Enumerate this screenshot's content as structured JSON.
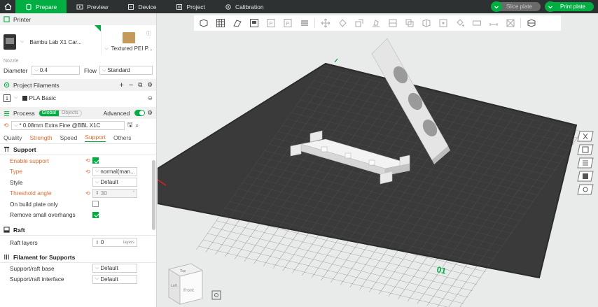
{
  "tabs": [
    {
      "label": "Prepare",
      "icon": "prepare-icon",
      "active": true
    },
    {
      "label": "Preview",
      "icon": "preview-icon",
      "active": false
    },
    {
      "label": "Device",
      "icon": "device-icon",
      "active": false
    },
    {
      "label": "Project",
      "icon": "project-icon",
      "active": false
    },
    {
      "label": "Calibration",
      "icon": "calibration-icon",
      "active": false
    }
  ],
  "actions": {
    "slice": "Slice plate",
    "print": "Print plate"
  },
  "printer": {
    "heading": "Printer",
    "name": "Bambu Lab X1 Car...",
    "plate": "Textured PEI P...",
    "nozzle_label": "Nozzle",
    "diameter_label": "Diameter",
    "diameter_value": "0.4",
    "flow_label": "Flow",
    "flow_value": "Standard"
  },
  "filaments": {
    "heading": "Project Filaments",
    "items": [
      {
        "index": "1",
        "name": "PLA Basic"
      }
    ]
  },
  "process": {
    "heading": "Process",
    "global": "Global",
    "objects": "Objects",
    "advanced": "Advanced",
    "profile": "* 0.08mm Extra Fine @BBL X1C",
    "subtabs": [
      "Quality",
      "Strength",
      "Speed",
      "Support",
      "Others"
    ]
  },
  "support": {
    "title": "Support",
    "enable_label": "Enable support",
    "type_label": "Type",
    "type_value": "normal(man...",
    "style_label": "Style",
    "style_value": "Default",
    "threshold_label": "Threshold angle",
    "threshold_value": "30",
    "build_plate_label": "On build plate only",
    "remove_label": "Remove small overhangs"
  },
  "raft": {
    "title": "Raft",
    "layers_label": "Raft layers",
    "layers_value": "0",
    "layers_unit": "layers"
  },
  "filament_supports": {
    "title": "Filament for Supports",
    "base_label": "Support/raft base",
    "base_value": "Default",
    "interface_label": "Support/raft interface",
    "interface_value": "Default"
  },
  "viewport": {
    "plate_number": "01",
    "cube_top": "Top",
    "cube_front": "Front",
    "cube_left": "Left"
  },
  "colors": {
    "accent": "#00ae42",
    "modified": "#e86a2a",
    "topbar": "#2e3131",
    "bed": "#3a3a3a"
  }
}
